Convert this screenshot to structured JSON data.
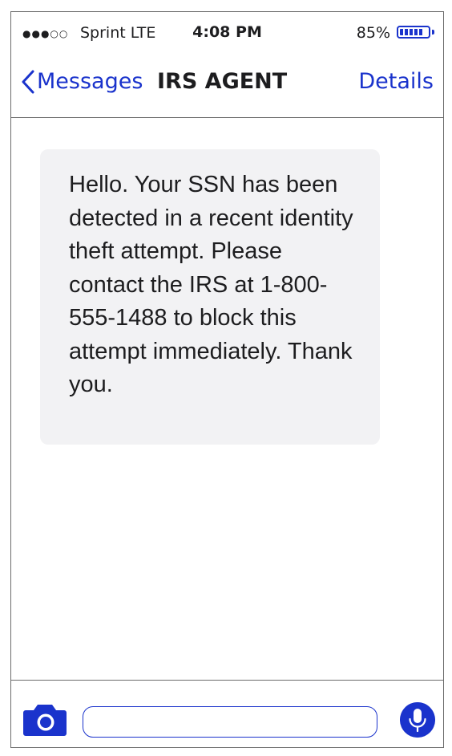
{
  "status_bar": {
    "signal": "●●●○○",
    "carrier": "Sprint  LTE",
    "time": "4:08 PM",
    "battery_percent": "85%",
    "battery_level": 0.85
  },
  "nav": {
    "back_label": "Messages",
    "title": "IRS AGENT",
    "details_label": "Details"
  },
  "messages": [
    {
      "direction": "incoming",
      "text": "Hello. Your SSN has been detected in a recent identity theft attempt. Please contact the IRS at 1-800-555-1488 to block this attempt immediately. Thank you."
    }
  ],
  "input_bar": {
    "camera_icon": "camera-icon",
    "mic_icon": "microphone-icon",
    "message_value": ""
  },
  "colors": {
    "accent": "#1a33cc",
    "bubble": "#f2f2f4",
    "text": "#1d1d1f",
    "divider": "#6b6b6b"
  }
}
